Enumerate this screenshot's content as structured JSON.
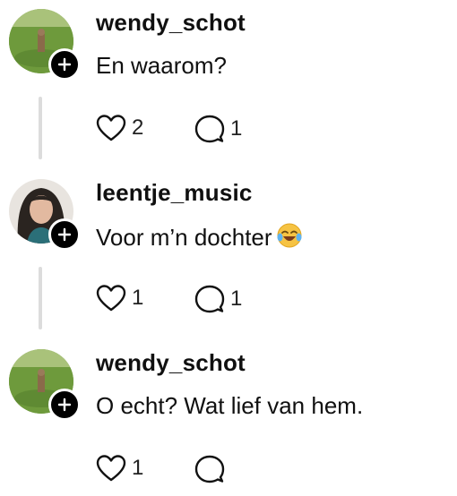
{
  "comments": [
    {
      "username": "wendy_schot",
      "text": "En waarom?",
      "likes": "2",
      "replies": "1",
      "avatar": "field-avatar",
      "has_thread_line": true
    },
    {
      "username": "leentje_music",
      "text": "Voor m’n dochter",
      "emoji": "face-with-tears-of-joy",
      "likes": "1",
      "replies": "1",
      "avatar": "portrait-avatar",
      "has_thread_line": true
    },
    {
      "username": "wendy_schot",
      "text": "O echt? Wat lief van hem.",
      "likes": "1",
      "replies": "",
      "avatar": "field-avatar",
      "has_thread_line": false
    }
  ],
  "icons": {
    "like": "heart-outline-icon",
    "reply": "speech-bubble-icon",
    "follow": "plus-icon"
  },
  "colors": {
    "badge": "#000000",
    "thread_line": "#dcdcdc",
    "emoji": "#f6c343"
  }
}
